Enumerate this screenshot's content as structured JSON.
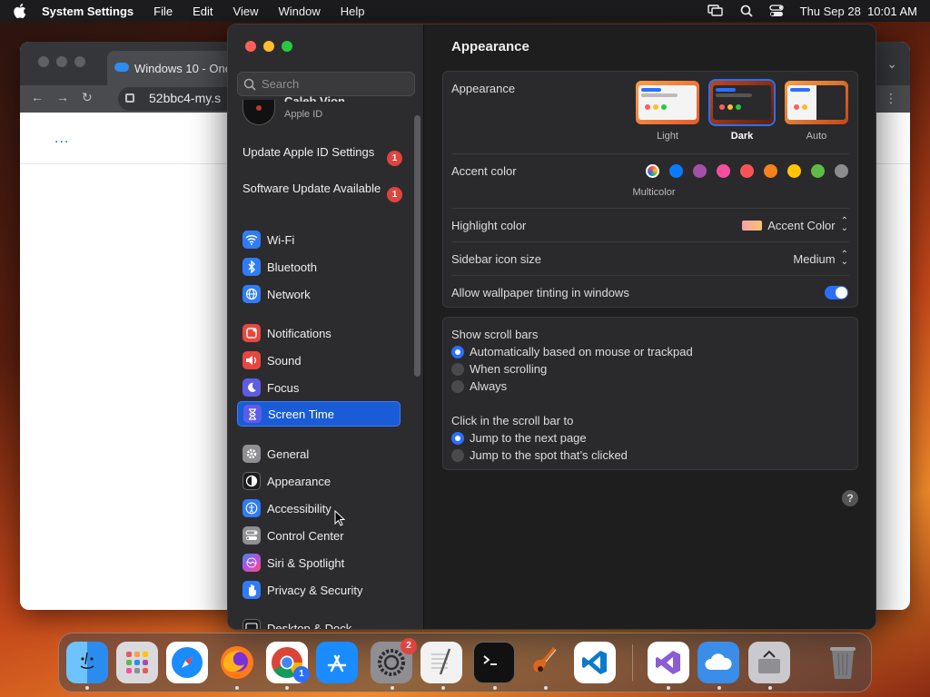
{
  "menubar": {
    "app_name": "System Settings",
    "menus": [
      "File",
      "Edit",
      "View",
      "Window",
      "Help"
    ],
    "clock": "Thu Sep 28  10:01 AM"
  },
  "browser": {
    "tab_title": "Windows 10 - One",
    "url": "52bbc4-my.s",
    "content_dots": "..."
  },
  "sidebar": {
    "search_placeholder": "Search",
    "profile": {
      "name": "Caleb Vion",
      "subtitle": "Apple ID"
    },
    "notices": [
      {
        "label": "Update Apple ID Settings",
        "badge": "1"
      },
      {
        "label": "Software Update Available",
        "badge": "1"
      }
    ],
    "items": [
      {
        "label": "Wi-Fi",
        "icon": "wifi-icon",
        "color": "#2f7cf6"
      },
      {
        "label": "Bluetooth",
        "icon": "bluetooth-icon",
        "color": "#2f7cf6"
      },
      {
        "label": "Network",
        "icon": "globe-icon",
        "color": "#2f7cf6"
      },
      {
        "label": "Notifications",
        "icon": "bell-icon",
        "color": "#e8473f"
      },
      {
        "label": "Sound",
        "icon": "speaker-icon",
        "color": "#e8473f"
      },
      {
        "label": "Focus",
        "icon": "moon-icon",
        "color": "#5e5ce6"
      },
      {
        "label": "Screen Time",
        "icon": "hourglass-icon",
        "color": "#5e5ce6",
        "active": true
      },
      {
        "label": "General",
        "icon": "gear-icon",
        "color": "#8e8e93"
      },
      {
        "label": "Appearance",
        "icon": "appearance-icon",
        "color": "#1c1c1e"
      },
      {
        "label": "Accessibility",
        "icon": "accessibility-icon",
        "color": "#2f7cf6"
      },
      {
        "label": "Control Center",
        "icon": "toggles-icon",
        "color": "#8e8e93"
      },
      {
        "label": "Siri & Spotlight",
        "icon": "siri-icon",
        "color": "#b44fe0"
      },
      {
        "label": "Privacy & Security",
        "icon": "hand-icon",
        "color": "#2f7cf6"
      },
      {
        "label": "Desktop & Dock",
        "icon": "dock-icon",
        "color": "#1c1c1e"
      }
    ]
  },
  "main": {
    "title": "Appearance",
    "appearance": {
      "label": "Appearance",
      "options": [
        {
          "label": "Light",
          "selected": false
        },
        {
          "label": "Dark",
          "selected": true
        },
        {
          "label": "Auto",
          "selected": false
        }
      ]
    },
    "accent": {
      "label": "Accent color",
      "selected_label": "Multicolor",
      "colors": [
        "multicolor",
        "#0a7aff",
        "#a550a7",
        "#f74f9e",
        "#ff5257",
        "#f7821b",
        "#ffc600",
        "#62ba46",
        "#8c8c8c"
      ]
    },
    "highlight": {
      "label": "Highlight color",
      "value": "Accent Color"
    },
    "sidebar_icon_size": {
      "label": "Sidebar icon size",
      "value": "Medium"
    },
    "wallpaper_tinting": {
      "label": "Allow wallpaper tinting in windows",
      "on": true
    },
    "scroll_bars": {
      "label": "Show scroll bars",
      "options": [
        {
          "label": "Automatically based on mouse or trackpad",
          "on": true
        },
        {
          "label": "When scrolling",
          "on": false
        },
        {
          "label": "Always",
          "on": false
        }
      ]
    },
    "click_scroll": {
      "label": "Click in the scroll bar to",
      "options": [
        {
          "label": "Jump to the next page",
          "on": true
        },
        {
          "label": "Jump to the spot that’s clicked",
          "on": false
        }
      ]
    },
    "help": "?"
  },
  "dock": {
    "items": [
      {
        "name": "finder",
        "color": "#2b8cf0"
      },
      {
        "name": "launchpad",
        "color": "#d9d9de"
      },
      {
        "name": "safari",
        "color": "#1a8cff"
      },
      {
        "name": "firefox",
        "color": "#ff7a1a"
      },
      {
        "name": "chrome",
        "color": "#ffffff",
        "badge": "1"
      },
      {
        "name": "app-store",
        "color": "#1a8cff"
      },
      {
        "name": "system-settings",
        "color": "#8e8e93",
        "badge": "2"
      },
      {
        "name": "textedit",
        "color": "#f2f2f2"
      },
      {
        "name": "terminal",
        "color": "#111111"
      },
      {
        "name": "garageband",
        "color": "#ff8a1a"
      },
      {
        "name": "vscode",
        "color": "#ffffff"
      },
      {
        "name": "visual-studio",
        "color": "#ffffff"
      },
      {
        "name": "onedrive",
        "color": "#3a8de8"
      },
      {
        "name": "migration",
        "color": "#c9c9ce"
      },
      {
        "name": "trash",
        "color": "#7c7c80"
      }
    ]
  }
}
